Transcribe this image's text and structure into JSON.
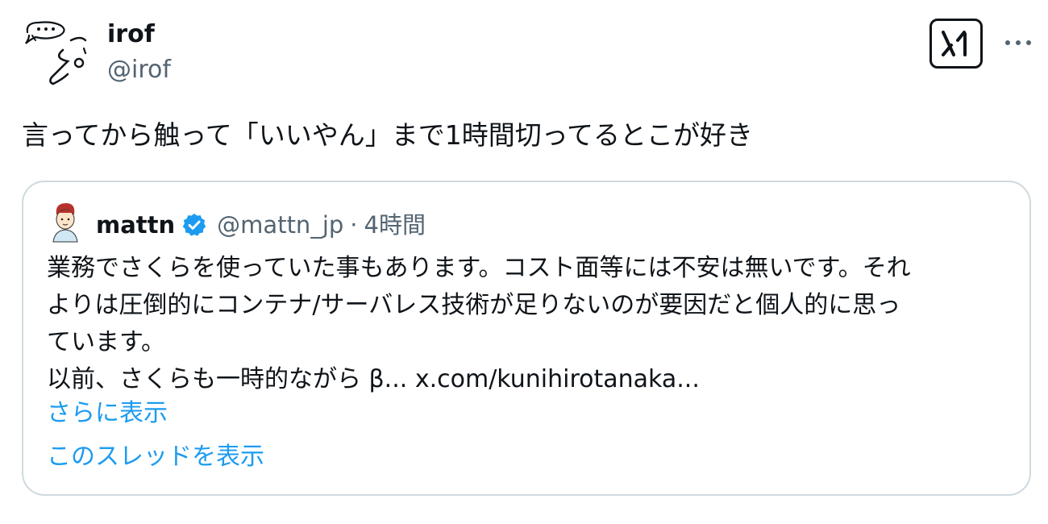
{
  "author": {
    "display_name": "irof",
    "handle": "@irof",
    "avatar_icon": "doodle-avatar-icon"
  },
  "header": {
    "brand_icon": "x-logo-icon",
    "more_icon": "more-options-icon"
  },
  "tweet": {
    "text": "言ってから触って「いいやん」まで1時間切ってるとこが好き"
  },
  "quote": {
    "author": {
      "display_name": "mattn",
      "handle": "@mattn_jp",
      "separator": "·",
      "time": "4時間",
      "verified_icon": "verified-badge-icon",
      "verified_color": "#1d9bf0"
    },
    "lines": [
      "業務でさくらを使っていた事もあります。コスト面等には不安は無いです。それ",
      "よりは圧倒的にコンテナ/サーバレス技術が足りないのが要因だと個人的に思っ",
      "ています。",
      "以前、さくらも一時的ながら β... x.com/kunihirotanaka..."
    ],
    "show_more": "さらに表示",
    "show_thread": "このスレッドを表示"
  },
  "colors": {
    "text": "#0f1419",
    "secondary": "#536471",
    "link": "#1d9bf0",
    "border": "#cfd9de"
  }
}
